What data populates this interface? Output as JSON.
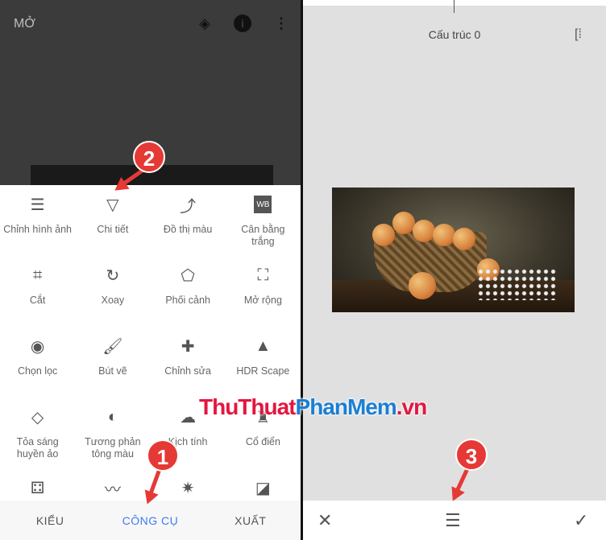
{
  "left": {
    "header": {
      "title": "MỞ",
      "icons": [
        "layers-undo-icon",
        "info-icon",
        "more-vert-icon"
      ]
    },
    "tools": [
      {
        "label": "Chỉnh hình ảnh",
        "icon": "tune-icon",
        "glyph": "☰"
      },
      {
        "label": "Chi tiết",
        "icon": "triangle-details-icon",
        "glyph": "▽"
      },
      {
        "label": "Đồ thị màu",
        "icon": "curves-icon",
        "glyph": "⤴"
      },
      {
        "label": "Cân bằng trắng",
        "icon": "white-balance-icon",
        "glyph": "WB"
      },
      {
        "label": "Cắt",
        "icon": "crop-icon",
        "glyph": "⌗"
      },
      {
        "label": "Xoay",
        "icon": "rotate-icon",
        "glyph": "↻"
      },
      {
        "label": "Phối cảnh",
        "icon": "perspective-icon",
        "glyph": "⬠"
      },
      {
        "label": "Mở rộng",
        "icon": "expand-icon",
        "glyph": "⛶"
      },
      {
        "label": "Chọn lọc",
        "icon": "selective-icon",
        "glyph": "◉"
      },
      {
        "label": "Bút vẽ",
        "icon": "brush-icon",
        "glyph": "🖌"
      },
      {
        "label": "Chỉnh sửa",
        "icon": "healing-icon",
        "glyph": "✚"
      },
      {
        "label": "HDR Scape",
        "icon": "mountains-icon",
        "glyph": "▲"
      },
      {
        "label": "Tỏa sáng huyền ảo",
        "icon": "glamour-glow-icon",
        "glyph": "◇"
      },
      {
        "label": "Tương phản tông màu",
        "icon": "tonal-contrast-icon",
        "glyph": "◐"
      },
      {
        "label": "Kịch tính",
        "icon": "drama-cloud-icon",
        "glyph": "☁"
      },
      {
        "label": "Cổ điển",
        "icon": "vintage-lamp-icon",
        "glyph": "♜"
      },
      {
        "label": "",
        "icon": "grainy-film-icon",
        "glyph": "⚃"
      },
      {
        "label": "",
        "icon": "mustache-icon",
        "glyph": "〰"
      },
      {
        "label": "",
        "icon": "guitar-grunge-icon",
        "glyph": "✷"
      },
      {
        "label": "",
        "icon": "frame-icon",
        "glyph": "◪"
      }
    ],
    "bottom_tabs": [
      {
        "label": "KIỂU"
      },
      {
        "label": "CÔNG CỤ",
        "active": true
      },
      {
        "label": "XUẤT"
      }
    ]
  },
  "right": {
    "title": "Cấu trúc 0",
    "icons": [
      "compare-icon",
      "close-icon",
      "adjust-icon",
      "check-icon"
    ]
  },
  "annotations": {
    "badges": [
      "1",
      "2",
      "3"
    ]
  },
  "watermark": {
    "part1": "ThuThuat",
    "part2": "PhanMem",
    "part3": ".vn"
  },
  "colors": {
    "accent": "#3d7cf0",
    "badge": "#e53935"
  }
}
